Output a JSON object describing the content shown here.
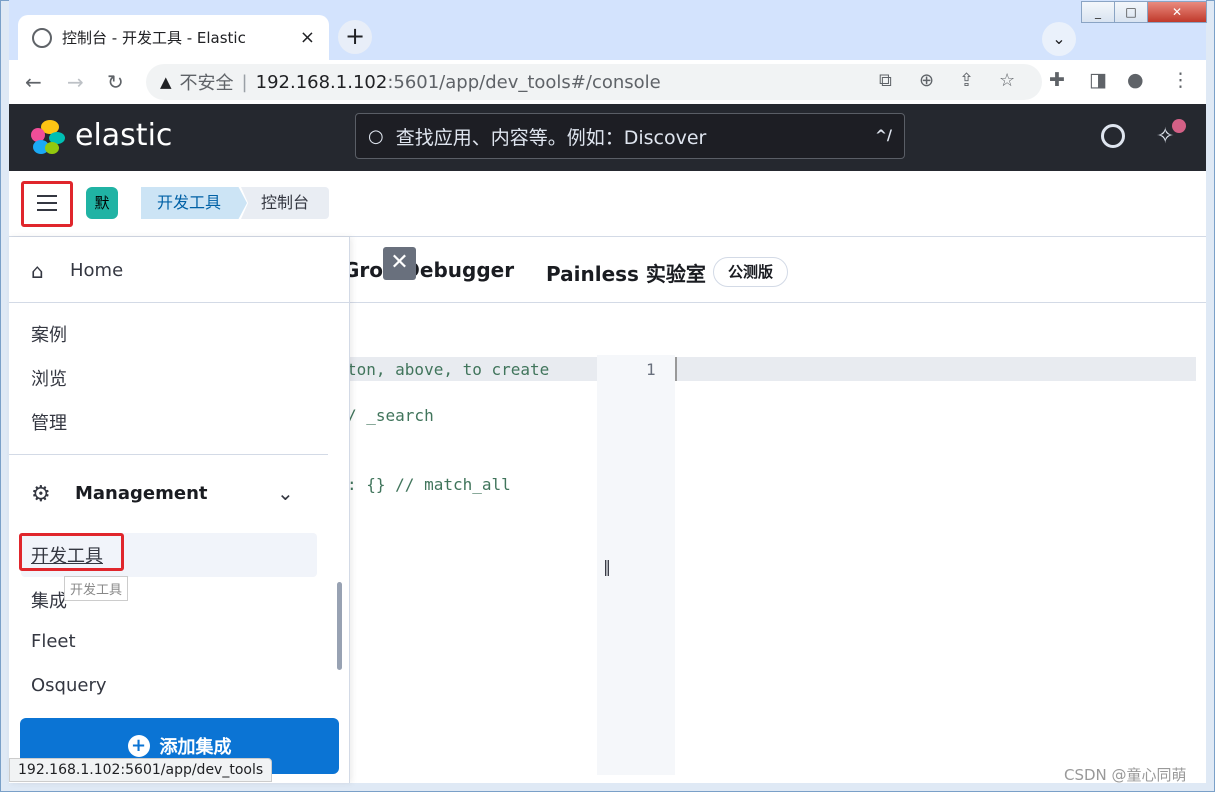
{
  "browser": {
    "tab_title": "控制台 - 开发工具 - Elastic",
    "tab_close": "×",
    "new_tab": "+",
    "insecure_label": "不安全",
    "url_host": "192.168.1.102",
    "url_path": ":5601/app/dev_tools#/console",
    "window_buttons": [
      "_",
      "□",
      "✕"
    ]
  },
  "kibana": {
    "brand": "elastic",
    "search_placeholder": "查找应用、内容等。例如：Discover",
    "search_shortcut": "^/",
    "space_initial": "默",
    "breadcrumbs": [
      "开发工具",
      "控制台"
    ]
  },
  "devtools": {
    "tab_grok": "Grok Debugger",
    "tab_painless": "Painless 实验室",
    "beta_badge": "公测版",
    "close_glyph": "✕",
    "code_lines": [
      "ton, above, to create",
      "/ _search",
      ": {} // match_all"
    ],
    "line_number": "1",
    "resizer": "‖"
  },
  "sidenav": {
    "home": "Home",
    "items": [
      "案例",
      "浏览",
      "管理"
    ],
    "management_label": "Management",
    "management_items": [
      "开发工具",
      "集成",
      "Fleet",
      "Osquery"
    ],
    "tooltip": "开发工具",
    "add_button": "添加集成"
  },
  "status_url": "192.168.1.102:5601/app/dev_tools",
  "watermark": "CSDN @童心同萌",
  "colors": {
    "kibana_header": "#25282f",
    "primary_button": "#0b74d4",
    "highlight_box": "#e0262c",
    "space_badge": "#20b3a4"
  }
}
